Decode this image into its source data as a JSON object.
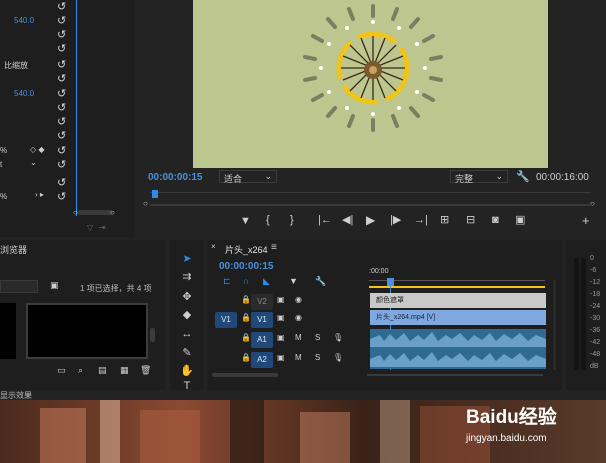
{
  "effects": {
    "values": [
      "540.0",
      "540.0"
    ],
    "scale_label": "比缩放",
    "pct": "%"
  },
  "program": {
    "timecode": "00:00:00:15",
    "zoom": "适合",
    "quality": "完整",
    "duration": "00:00:16:00"
  },
  "project": {
    "title": "浏览器",
    "selection_info": "1 项已选择，共 4 项"
  },
  "timeline": {
    "tab_name": "片头_x264",
    "menu_icon": "≡",
    "timecode": "00:00:00:15",
    "ruler_label": ":00:00",
    "tracks": [
      {
        "name": "V2",
        "source": ""
      },
      {
        "name": "V1",
        "source": "V1"
      },
      {
        "name": "A1",
        "source": ""
      },
      {
        "name": "A2",
        "source": ""
      }
    ],
    "clip_v2": "颜色遮罩",
    "clip_v1": "片头_x264.mp4 [V]",
    "mute": "M",
    "solo": "S"
  },
  "meters": {
    "labels": [
      "0",
      "-6",
      "-12",
      "-18",
      "-24",
      "-30",
      "-36",
      "-42",
      "-48",
      "dB"
    ]
  },
  "status_bar": {
    "text": "显示效果"
  },
  "watermark": {
    "brand": "Baidu经验",
    "url": "jingyan.baidu.com"
  },
  "colors": {
    "accent": "#2d8ceb",
    "timecode_blue": "#4a90d9",
    "video_bg": "#bec68f",
    "clip_v2": "#c9c9c9",
    "clip_v1": "#7fa8e0",
    "audio_clip": "#2f6a93",
    "playhead": "#4a8fe0"
  }
}
